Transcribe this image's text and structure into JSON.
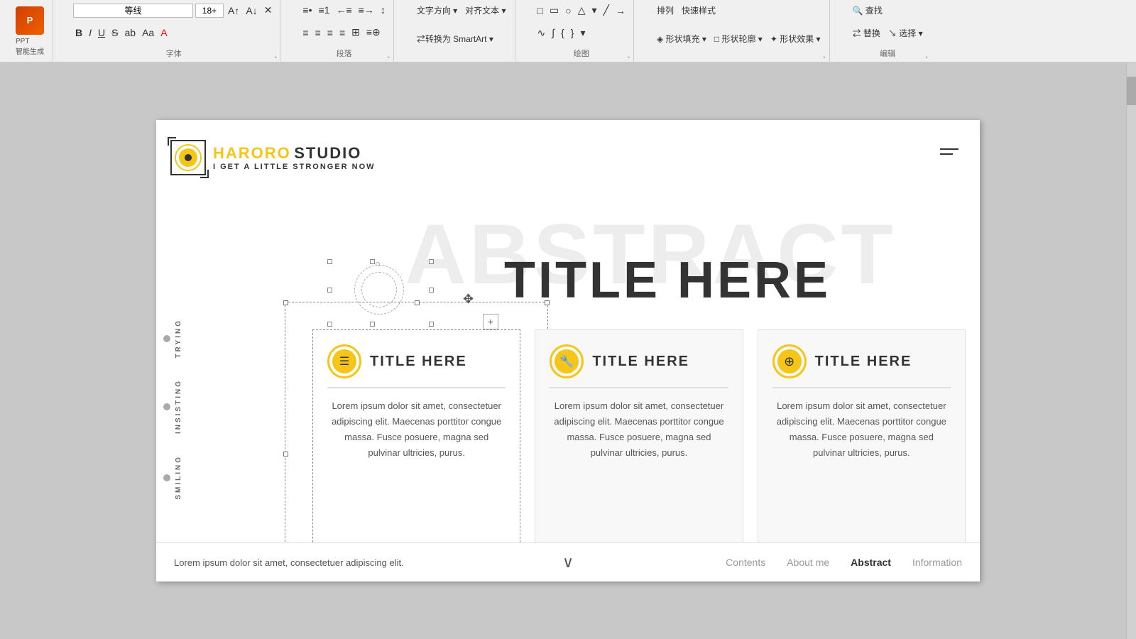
{
  "toolbar": {
    "ppt_label": "PPT\n智能生成",
    "font_name": "等线",
    "font_size": "18+",
    "sections": {
      "ziTi": "字体",
      "duanLuo": "段落",
      "huiTu": "绘图",
      "paiLie": "排列",
      "kuaiSuYangShi": "快速样式",
      "bianJi": "编辑"
    },
    "buttons": {
      "bold": "B",
      "italic": "I",
      "underline": "U",
      "strikethrough": "S",
      "textA": "A",
      "textColor": "A",
      "alignLeft": "≡",
      "alignCenter": "≡",
      "alignRight": "≡",
      "justify": "≡",
      "indent": "≡",
      "moreAlign": "≡",
      "search": "查找",
      "replace": "替换",
      "select": "选择"
    }
  },
  "slide": {
    "logo": {
      "brand1": "HARORO",
      "brand2": " STUDIO",
      "subtitle": "I GET A LITTLE STRONGER NOW"
    },
    "watermark": "ABSTRACT",
    "main_title": "TITLE HERE",
    "cards": [
      {
        "id": "card1",
        "title": "TITLE HERE",
        "icon": "≡",
        "body": "Lorem ipsum dolor sit amet, consectetuer adipiscing elit. Maecenas porttitor congue massa. Fusce posuere, magna sed pulvinar ultricies, purus."
      },
      {
        "id": "card2",
        "title": "TITLE HERE",
        "icon": "🔧",
        "body": "Lorem ipsum dolor sit amet, consectetuer adipiscing elit. Maecenas porttitor congue massa. Fusce posuere, magna sed pulvinar ultricies, purus."
      },
      {
        "id": "card3",
        "title": "TITLE HERE",
        "icon": "⊕",
        "body": "Lorem ipsum dolor sit amet, consectetuer adipiscing elit. Maecenas porttitor congue massa. Fusce posuere, magna sed pulvinar ultricies, purus."
      }
    ],
    "side_labels": [
      "TRYING",
      "INSISTING",
      "SMILING"
    ],
    "footer": {
      "text": "Lorem ipsum dolor sit amet, consectetuer adipiscing elit.",
      "nav": [
        "Contents",
        "About me",
        "Abstract",
        "Information"
      ],
      "active_nav": "Abstract"
    }
  }
}
